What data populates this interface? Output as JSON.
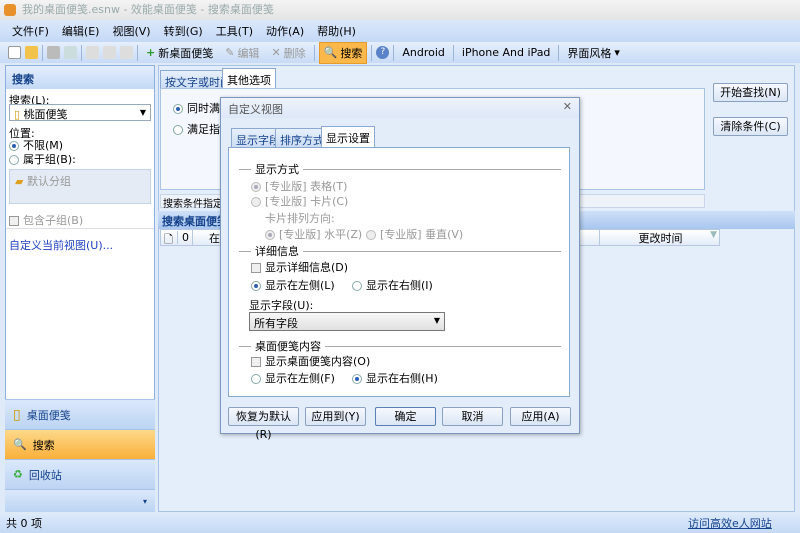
{
  "window": {
    "title": "我的桌面便笺.esnw - 效能桌面便笺 - 搜索桌面便笺"
  },
  "menu": [
    "文件(F)",
    "编辑(E)",
    "视图(V)",
    "转到(G)",
    "工具(T)",
    "动作(A)",
    "帮助(H)"
  ],
  "toolbar": {
    "new_note": "新桌面便笺",
    "edit": "编辑",
    "delete": "删除",
    "search": "搜索",
    "android": "Android",
    "iphone": "iPhone And iPad",
    "skin": "界面风格"
  },
  "left": {
    "header": "搜索",
    "search_label": "搜索(L):",
    "search_value": "桃面便笺",
    "location_label": "位置:",
    "loc_any": "不限(M)",
    "loc_group": "属于组(B):",
    "group_name": "默认分组",
    "include_sub": "包含子组(B)",
    "customize_link": "自定义当前视图(U)..."
  },
  "nav": {
    "notes": "桌面便笺",
    "search": "搜索",
    "recycle": "回收站"
  },
  "main": {
    "tab_text": "按文字或时间",
    "tab_other": "其他选项",
    "opt_all": "同时满足",
    "opt_any": "满足指定",
    "start": "开始查找(N)",
    "clear": "清除条件(C)",
    "criteria_bar": "搜索条件指定",
    "results_header": "搜索桌面便笺",
    "col_in": "在",
    "col_modified": "更改时间"
  },
  "dialog": {
    "title": "自定义视图",
    "tabs": [
      "显示字段",
      "排序方式",
      "显示设置"
    ],
    "display_mode": "显示方式",
    "table": "[专业版] 表格(T)",
    "card": "[专业版] 卡片(C)",
    "card_dir": "卡片排列方向:",
    "horizontal": "[专业版] 水平(Z)",
    "vertical": "[专业版] 垂直(V)",
    "details": "详细信息",
    "show_details": "显示详细信息(D)",
    "left": "显示在左侧(L)",
    "right": "显示在右侧(I)",
    "fields_label": "显示字段(U):",
    "fields_value": "所有字段",
    "content": "桌面便笺内容",
    "show_content": "显示桌面便笺内容(O)",
    "c_left": "显示在左侧(F)",
    "c_right": "显示在右侧(H)",
    "btn_reset": "恢复为默认(R)",
    "btn_apply_to": "应用到(Y)",
    "btn_ok": "确定",
    "btn_cancel": "取消",
    "btn_apply": "应用(A)"
  },
  "status": {
    "count": "共 0 项",
    "link": "访问高效e人网站"
  }
}
